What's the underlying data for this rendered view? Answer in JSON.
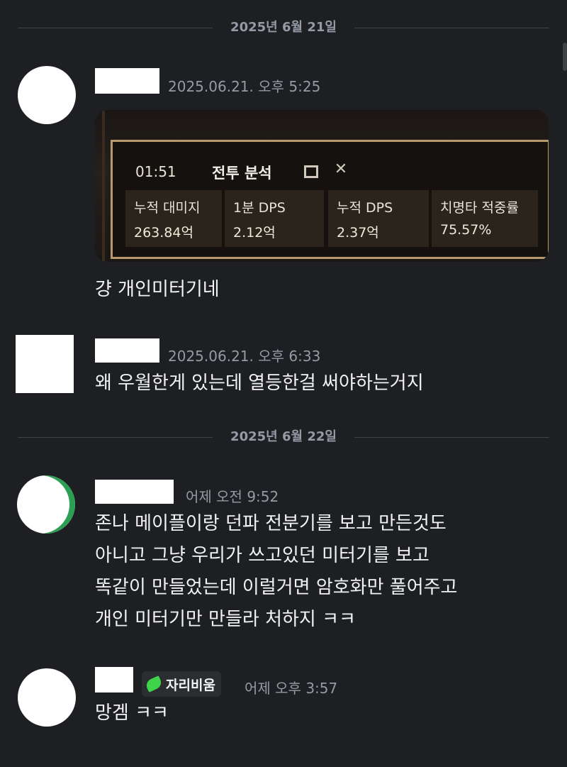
{
  "dividers": [
    {
      "label": "2025년 6월 21일"
    },
    {
      "label": "2025년 6월 22일"
    }
  ],
  "messages": [
    {
      "timestamp": "2025.06.21. 오후 5:25",
      "text": "걍 개인미터기네",
      "attachment": {
        "timer": "01:51",
        "title": "전투 분석",
        "cells": [
          {
            "label": "누적 대미지",
            "value": "263.84억"
          },
          {
            "label": "1분 DPS",
            "value": "2.12억"
          },
          {
            "label": "누적 DPS",
            "value": "2.37억"
          },
          {
            "label": "치명타 적중률",
            "value": "75.57%"
          }
        ]
      }
    },
    {
      "timestamp": "2025.06.21. 오후 6:33",
      "text": "왜 우월한게 있는데 열등한걸 써야하는거지"
    },
    {
      "timestamp": "어제 오전 9:52",
      "lines": [
        "존나 메이플이랑 던파 전분기를 보고 만든것도",
        "아니고 그냥 우리가 쓰고있던 미터기를 보고",
        "똑같이 만들었는데 이럴거면 암호화만 풀어주고",
        "개인 미터기만 만들라 처하지 ㅋㅋ"
      ]
    },
    {
      "timestamp": "어제 오후 3:57",
      "role_badge": "자리비움",
      "role_icon": "leaf-icon",
      "text": "망겜 ㅋㅋ"
    }
  ],
  "colors": {
    "background": "#1e1f22",
    "muted_text": "#949ba4",
    "message_text": "#f2f3f5",
    "role_icon": "#3fd34a"
  }
}
